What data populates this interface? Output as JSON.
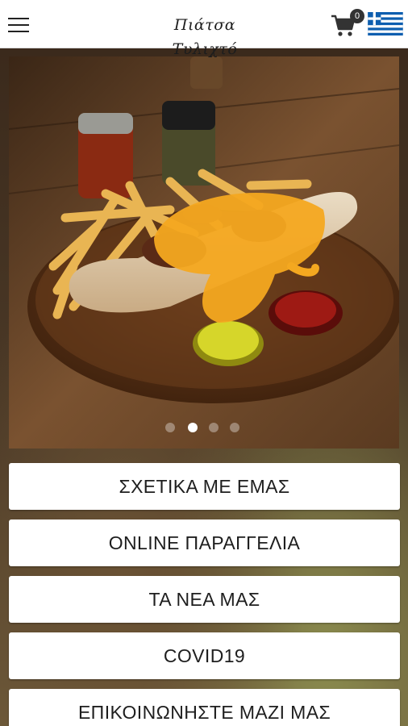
{
  "header": {
    "logo_text": "Πιάτσα Τυλιχτό",
    "cart_count": "0",
    "language_icon": "greek-flag-icon",
    "menu_icon": "hamburger-menu-icon",
    "cart_icon": "shopping-cart-icon"
  },
  "slider": {
    "total_slides": 4,
    "active_slide": 2
  },
  "nav": {
    "about": "ΣΧΕΤΙΚΑ ΜΕ ΕΜΑΣ",
    "order": "ONLINE ΠΑΡΑΓΓΕΛΙΑ",
    "news": "ΤΑ ΝΕΑ ΜΑΣ",
    "covid": "COVID19",
    "contact": "ΕΠΙΚΟΙΝΩΝΗΣΤΕ ΜΑΖΙ ΜΑΣ"
  },
  "colors": {
    "flag_blue": "#0d5eaf",
    "header_bg": "#ffffff",
    "button_bg": "#ffffff",
    "sauce_yellow": "#f4a820"
  }
}
